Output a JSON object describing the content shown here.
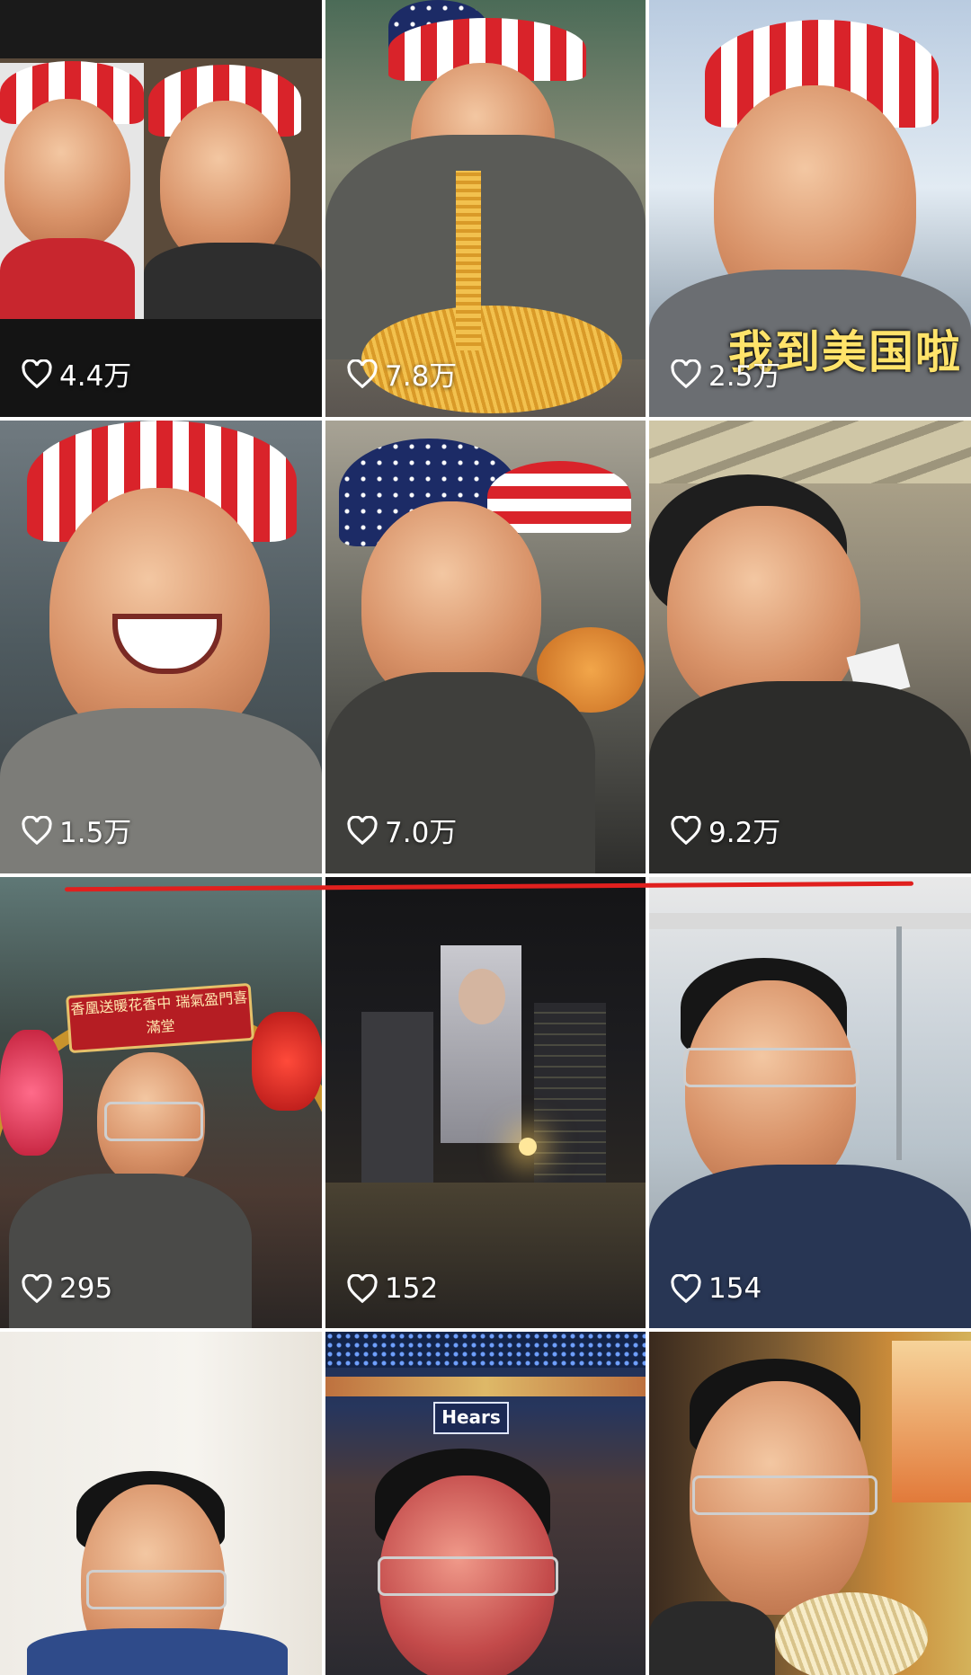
{
  "videos": [
    {
      "likes": "4.4万"
    },
    {
      "likes": "7.8万"
    },
    {
      "likes": "2.5万",
      "caption": "我到美国啦"
    },
    {
      "likes": "1.5万"
    },
    {
      "likes": "7.0万"
    },
    {
      "likes": "9.2万"
    },
    {
      "likes": "295"
    },
    {
      "likes": "152"
    },
    {
      "likes": "154"
    },
    {
      "likes": ""
    },
    {
      "likes": ""
    },
    {
      "likes": ""
    }
  ],
  "signs": {
    "arch_banner": "香凰送暖花香中 瑞氣盈門喜滿堂",
    "storefront": "Hears"
  },
  "colors": {
    "heart": "#ffffff",
    "annotation_line": "#e0201e",
    "caption": "#ffe36a"
  }
}
